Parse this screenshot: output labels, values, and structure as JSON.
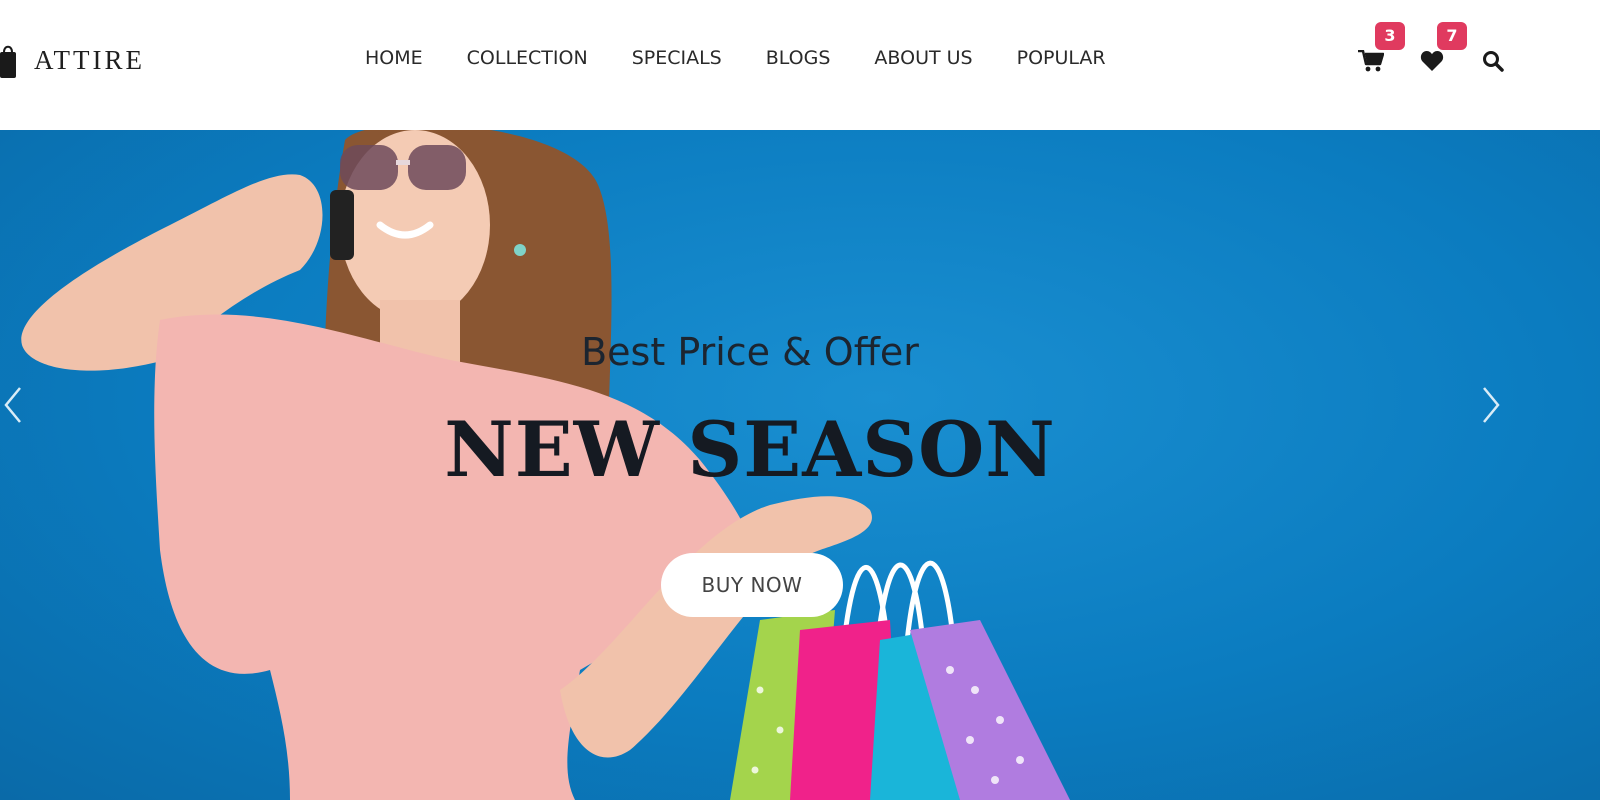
{
  "brand": {
    "name": "ATTIRE"
  },
  "nav": [
    "HOME",
    "COLLECTION",
    "SPECIALS",
    "BLOGS",
    "ABOUT US",
    "POPULAR"
  ],
  "icons": {
    "cart": {
      "icon": "cart-icon",
      "count": "3"
    },
    "wishlist": {
      "icon": "heart-icon",
      "count": "7"
    },
    "search": {
      "icon": "search-icon"
    },
    "badge_color": "#e03a5f"
  },
  "hero": {
    "subtitle": "Best Price & Offer",
    "title": "NEW SEASON",
    "button": "BUY NOW",
    "background": "#0b7cc0"
  }
}
